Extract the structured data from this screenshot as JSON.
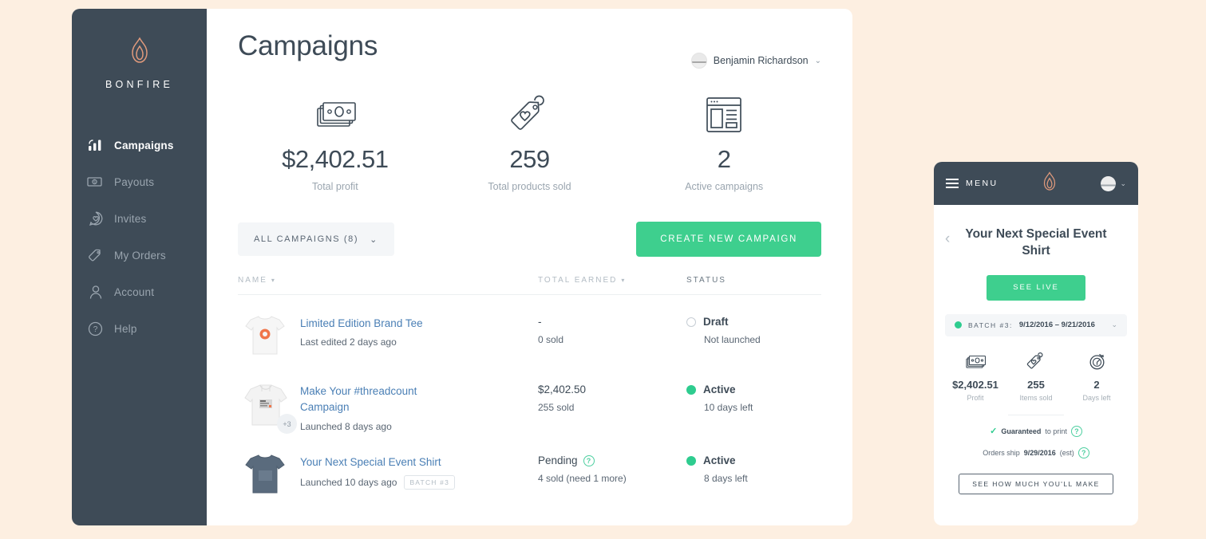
{
  "brand": {
    "name": "BONFIRE",
    "mark": "flame-logo",
    "color": "#e09a7c"
  },
  "sidebar": {
    "items": [
      {
        "label": "Campaigns",
        "icon": "bar-chart-icon",
        "active": true
      },
      {
        "label": "Payouts",
        "icon": "money-bill-icon",
        "active": false
      },
      {
        "label": "Invites",
        "icon": "heart-chat-icon",
        "active": false
      },
      {
        "label": "My Orders",
        "icon": "tag-icon",
        "active": false
      },
      {
        "label": "Account",
        "icon": "person-icon",
        "active": false
      },
      {
        "label": "Help",
        "icon": "question-circle-icon",
        "active": false
      }
    ]
  },
  "header": {
    "title": "Campaigns",
    "user_name": "Benjamin Richardson",
    "caret": "⌄"
  },
  "stats": [
    {
      "icon": "money-bill-icon",
      "value": "$2,402.51",
      "label": "Total profit"
    },
    {
      "icon": "heart-tag-icon",
      "value": "259",
      "label": "Total products sold"
    },
    {
      "icon": "campaign-window-icon",
      "value": "2",
      "label": "Active campaigns"
    }
  ],
  "actions": {
    "filter_label": "ALL CAMPAIGNS (8)",
    "filter_caret": "⌄",
    "create_label": "CREATE NEW CAMPAIGN",
    "accent_green": "#3ecf8e"
  },
  "table": {
    "headers": {
      "name": "NAME",
      "earned": "TOTAL EARNED",
      "status": "STATUS",
      "sort_caret": "▾"
    },
    "rows": [
      {
        "thumb": "white-tshirt-orange-circle",
        "name": "Limited Edition Brand Tee",
        "sub": "Last edited 2 days ago",
        "batch": "",
        "earned": "-",
        "earned_sub": "0 sold",
        "has_info": false,
        "status": "Draft",
        "status_type": "draft",
        "status_sub": "Not launched"
      },
      {
        "thumb": "white-hoodie",
        "thumb_badge": "+3",
        "name": "Make Your #threadcount Campaign",
        "sub": "Launched 8 days ago",
        "batch": "",
        "earned": "$2,402.50",
        "earned_sub": "255 sold",
        "has_info": false,
        "status": "Active",
        "status_type": "active",
        "status_sub": "10 days left"
      },
      {
        "thumb": "navy-tshirt",
        "name": "Your Next Special Event Shirt",
        "sub": "Launched 10 days ago",
        "batch": "BATCH #3",
        "earned": "Pending",
        "earned_sub": "4 sold (need 1 more)",
        "has_info": true,
        "status": "Active",
        "status_type": "active",
        "status_sub": "8 days left"
      }
    ]
  },
  "mobile": {
    "menu_label": "MENU",
    "logo": "flame-logo",
    "caret": "⌄",
    "back": "‹",
    "title": "Your Next Special Event Shirt",
    "see_live_label": "SEE LIVE",
    "batch_label": "BATCH #3:",
    "batch_range": "9/12/2016 – 9/21/2016",
    "batch_caret": "⌄",
    "stats": [
      {
        "icon": "money-bill-icon",
        "value": "$2,402.51",
        "label": "Profit"
      },
      {
        "icon": "heart-tag-icon",
        "value": "255",
        "label": "Items sold"
      },
      {
        "icon": "stopwatch-icon",
        "value": "2",
        "label": "Days left"
      }
    ],
    "guarantee_check": "✓",
    "guarantee_bold": "Guaranteed",
    "guarantee_rest": "to print",
    "ship_prefix": "Orders ship",
    "ship_date": "9/29/2016",
    "ship_suffix": "(est)",
    "info_glyph": "?",
    "make_btn_label": "SEE HOW MUCH YOU'LL MAKE"
  }
}
